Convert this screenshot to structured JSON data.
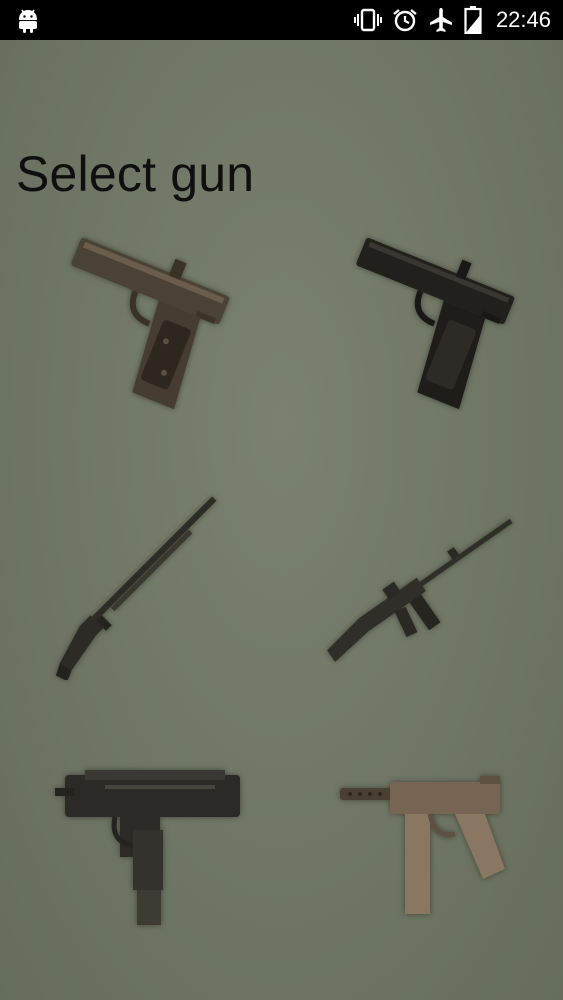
{
  "status_bar": {
    "time": "22:46",
    "icons": [
      "android-icon",
      "vibrate-icon",
      "alarm-icon",
      "airplane-mode-icon",
      "battery-icon"
    ]
  },
  "page": {
    "title": "Select gun"
  },
  "guns": [
    {
      "icon": "pistol-1911-tan-icon",
      "color": "#4b4236"
    },
    {
      "icon": "pistol-1911-black-icon",
      "color": "#22201d"
    },
    {
      "icon": "shotgun-icon",
      "color": "#2c2b25"
    },
    {
      "icon": "assault-rifle-icon",
      "color": "#2f2e28"
    },
    {
      "icon": "uzi-icon",
      "color": "#2b2a26"
    },
    {
      "icon": "tec9-icon",
      "color": "#766552"
    }
  ],
  "colors": {
    "background": "#6e7564",
    "statusbar": "#000000",
    "title": "#0f0f0f"
  }
}
